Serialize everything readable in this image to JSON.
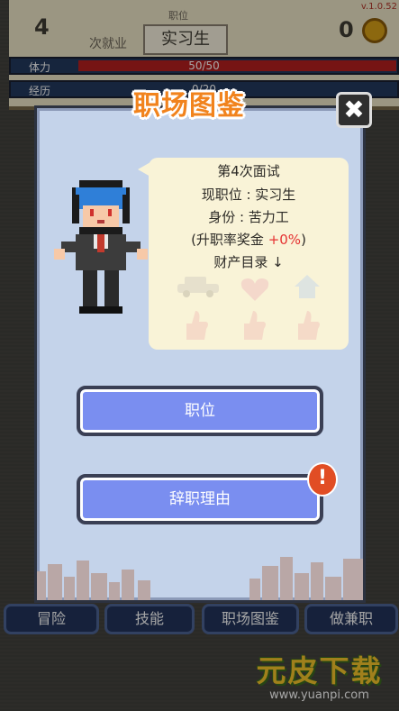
{
  "hud": {
    "interview_count": "4",
    "interview_label": "次就业",
    "position_label": "职位",
    "position_value": "实习生",
    "version": "v.1.0.52",
    "coins": "0",
    "hp_label": "体力",
    "hp_value": "50/50",
    "hp_fraction": 1.0,
    "exp_label": "经历",
    "exp_value": "0/20"
  },
  "modal": {
    "title": "职场图鉴",
    "bubble": {
      "line1": "第4次面试",
      "line2": "现职位 : 实习生",
      "line3": "身份 : 苦力工",
      "line4_prefix": "(升职率奖金 ",
      "line4_bonus": "+0%",
      "line4_suffix": ")",
      "line5": "财产目录 ↓"
    },
    "buttons": {
      "position": "职位",
      "resign": "辞职理由"
    },
    "alert_glyph": "!"
  },
  "nav": {
    "adventure": "冒险",
    "skills": "技能",
    "workplace_guide": "职场图鉴",
    "part_time": "做兼职"
  },
  "watermark": {
    "brand": "元皮下载",
    "url": "www.yuanpi.com"
  },
  "colors": {
    "modal_bg": "#c4d3ea",
    "title_orange": "#f1831d",
    "button_blue": "#7a8ef0",
    "bonus_red": "#e53232",
    "bubble_bg": "#f9f3d7"
  }
}
